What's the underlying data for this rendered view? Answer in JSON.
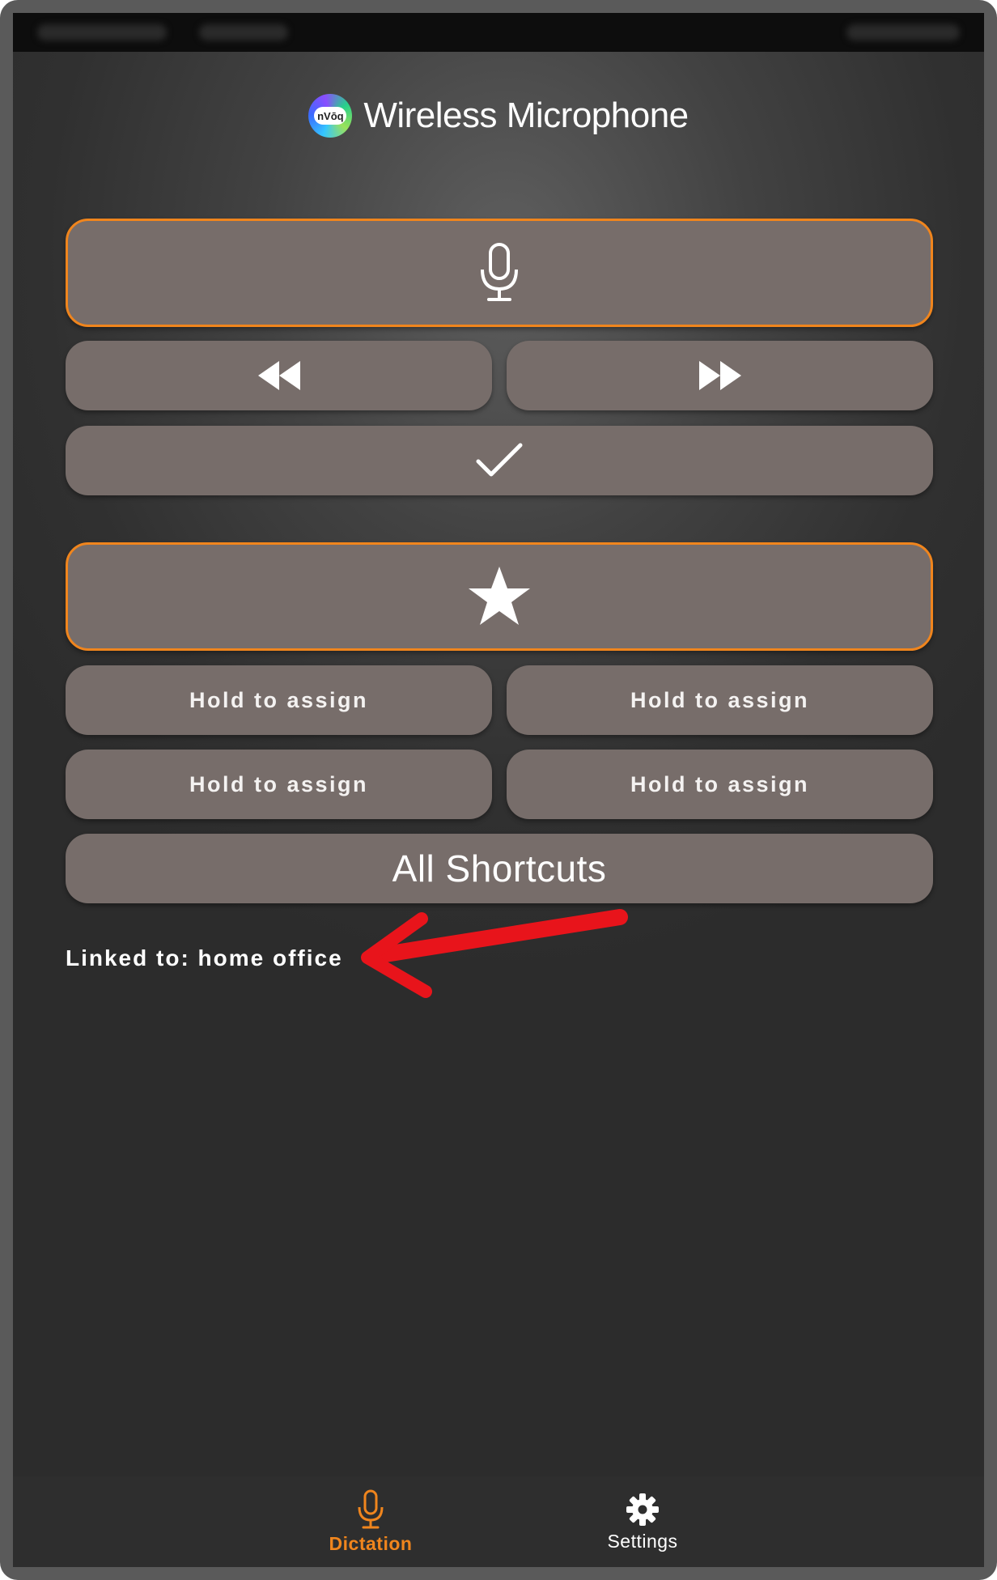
{
  "app": {
    "title": "Wireless Microphone",
    "logo_text": "nVōq"
  },
  "controls": {
    "record_icon": "microphone-icon",
    "rewind_icon": "rewind-icon",
    "fast_forward_icon": "fast-forward-icon",
    "confirm_icon": "checkmark-icon",
    "favorite_icon": "star-icon"
  },
  "shortcuts": {
    "slots": [
      {
        "label": "Hold to assign"
      },
      {
        "label": "Hold to assign"
      },
      {
        "label": "Hold to assign"
      },
      {
        "label": "Hold to assign"
      }
    ],
    "all_label": "All Shortcuts"
  },
  "status": {
    "linked_text": "Linked to: home office"
  },
  "nav": {
    "items": [
      {
        "label": "Dictation",
        "icon": "microphone-icon",
        "active": true
      },
      {
        "label": "Settings",
        "icon": "gear-icon",
        "active": false
      }
    ]
  },
  "colors": {
    "accent": "#f0851d",
    "button": "#776d6a",
    "annotation": "#e8141b"
  }
}
